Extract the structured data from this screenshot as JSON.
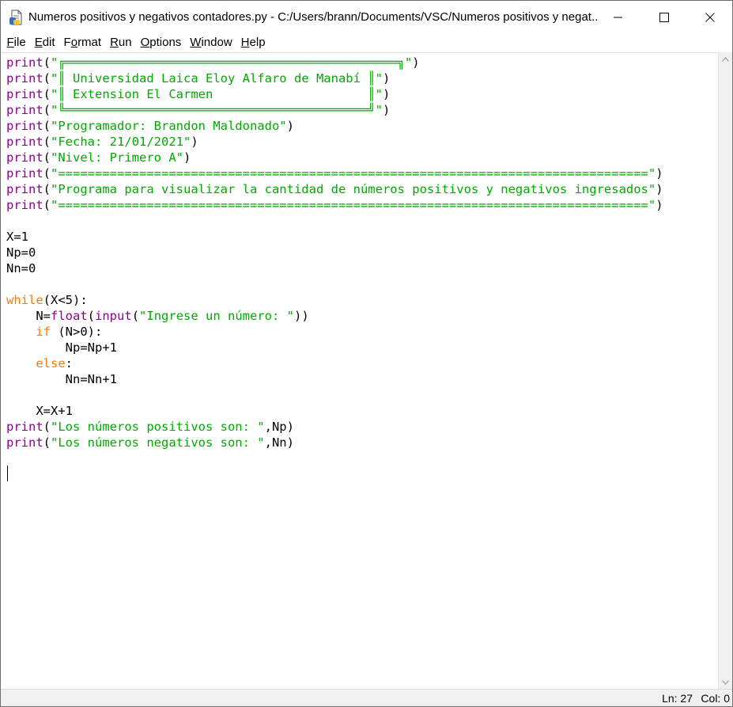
{
  "window": {
    "title": "Numeros positivos y negativos contadores.py - C:/Users/brann/Documents/VSC/Numeros positivos y negat..."
  },
  "menu": [
    {
      "pre": "",
      "u": "F",
      "post": "ile"
    },
    {
      "pre": "",
      "u": "E",
      "post": "dit"
    },
    {
      "pre": "F",
      "u": "o",
      "post": "rmat"
    },
    {
      "pre": "",
      "u": "R",
      "post": "un"
    },
    {
      "pre": "",
      "u": "O",
      "post": "ptions"
    },
    {
      "pre": "",
      "u": "W",
      "post": "indow"
    },
    {
      "pre": "",
      "u": "H",
      "post": "elp"
    }
  ],
  "code_lines": [
    [
      [
        "bi",
        "print"
      ],
      [
        "",
        "("
      ],
      [
        "st",
        "\"╔═════════════════════════════════════════════╗\""
      ],
      [
        "",
        ")"
      ]
    ],
    [
      [
        "bi",
        "print"
      ],
      [
        "",
        "("
      ],
      [
        "st",
        "\"║ Universidad Laica Eloy Alfaro de Manabí ║\""
      ],
      [
        "",
        ")"
      ]
    ],
    [
      [
        "bi",
        "print"
      ],
      [
        "",
        "("
      ],
      [
        "st",
        "\"║ Extension El Carmen                     ║\""
      ],
      [
        "",
        ")"
      ]
    ],
    [
      [
        "bi",
        "print"
      ],
      [
        "",
        "("
      ],
      [
        "st",
        "\"╚═════════════════════════════════════════╝\""
      ],
      [
        "",
        ")"
      ]
    ],
    [
      [
        "bi",
        "print"
      ],
      [
        "",
        "("
      ],
      [
        "st",
        "\"Programador: Brandon Maldonado\""
      ],
      [
        "",
        ")"
      ]
    ],
    [
      [
        "bi",
        "print"
      ],
      [
        "",
        "("
      ],
      [
        "st",
        "\"Fecha: 21/01/2021\""
      ],
      [
        "",
        ")"
      ]
    ],
    [
      [
        "bi",
        "print"
      ],
      [
        "",
        "("
      ],
      [
        "st",
        "\"Nivel: Primero A\""
      ],
      [
        "",
        ")"
      ]
    ],
    [
      [
        "bi",
        "print"
      ],
      [
        "",
        "("
      ],
      [
        "st",
        "\"================================================================================\""
      ],
      [
        "",
        ")"
      ]
    ],
    [
      [
        "bi",
        "print"
      ],
      [
        "",
        "("
      ],
      [
        "st",
        "\"Programa para visualizar la cantidad de números positivos y negativos ingresados\""
      ],
      [
        "",
        ")"
      ]
    ],
    [
      [
        "bi",
        "print"
      ],
      [
        "",
        "("
      ],
      [
        "st",
        "\"================================================================================\""
      ],
      [
        "",
        ")"
      ]
    ],
    [],
    [
      [
        "",
        "X=1"
      ]
    ],
    [
      [
        "",
        "Np=0"
      ]
    ],
    [
      [
        "",
        "Nn=0"
      ]
    ],
    [],
    [
      [
        "kw",
        "while"
      ],
      [
        "",
        "(X<5):"
      ]
    ],
    [
      [
        "",
        "    N="
      ],
      [
        "bi",
        "float"
      ],
      [
        "",
        "("
      ],
      [
        "bi",
        "input"
      ],
      [
        "",
        "("
      ],
      [
        "st",
        "\"Ingrese un número: \""
      ],
      [
        "",
        "))"
      ]
    ],
    [
      [
        "",
        "    "
      ],
      [
        "kw",
        "if"
      ],
      [
        "",
        " (N>0):"
      ]
    ],
    [
      [
        "",
        "        Np=Np+1"
      ]
    ],
    [
      [
        "",
        "    "
      ],
      [
        "kw",
        "else"
      ],
      [
        "",
        ":"
      ]
    ],
    [
      [
        "",
        "        Nn=Nn+1"
      ]
    ],
    [],
    [
      [
        "",
        "    X=X+1"
      ]
    ],
    [
      [
        "bi",
        "print"
      ],
      [
        "",
        "("
      ],
      [
        "st",
        "\"Los números positivos son: \""
      ],
      [
        "",
        ",Np)"
      ]
    ],
    [
      [
        "bi",
        "print"
      ],
      [
        "",
        "("
      ],
      [
        "st",
        "\"Los números negativos son: \""
      ],
      [
        "",
        ",Nn)"
      ]
    ],
    [],
    []
  ],
  "status": {
    "ln": "Ln: 27",
    "col": "Col: 0"
  },
  "colors": {
    "keyword": "#ff7700",
    "builtin": "#900090",
    "string": "#00aa00"
  }
}
